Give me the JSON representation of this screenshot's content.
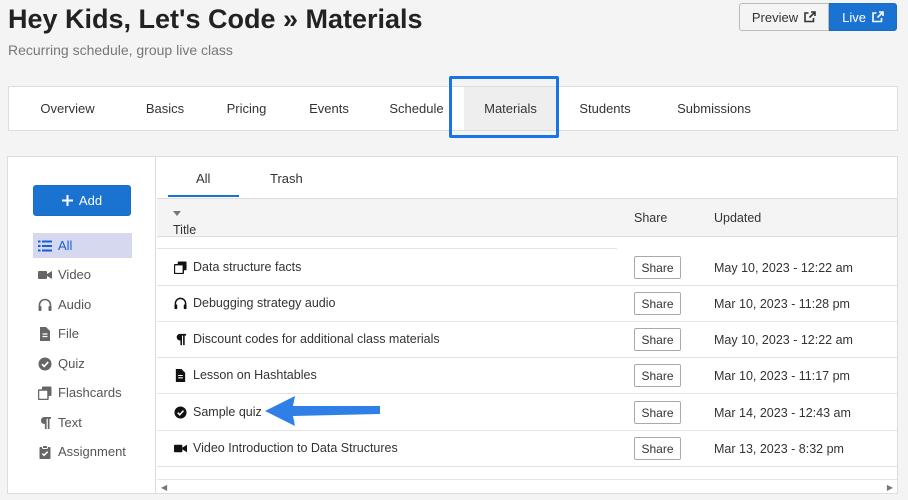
{
  "header": {
    "title": "Hey Kids, Let's Code » Materials",
    "subtitle": "Recurring schedule, group live class",
    "preview_label": "Preview",
    "live_label": "Live"
  },
  "tabs": [
    {
      "label": "Overview"
    },
    {
      "label": "Basics"
    },
    {
      "label": "Pricing"
    },
    {
      "label": "Events"
    },
    {
      "label": "Schedule"
    },
    {
      "label": "Materials",
      "active": true
    },
    {
      "label": "Students"
    },
    {
      "label": "Submissions"
    }
  ],
  "sidebar": {
    "add_label": "Add",
    "items": [
      {
        "label": "All",
        "icon": "list-icon",
        "active": true
      },
      {
        "label": "Video",
        "icon": "video-icon"
      },
      {
        "label": "Audio",
        "icon": "headphones-icon"
      },
      {
        "label": "File",
        "icon": "file-icon"
      },
      {
        "label": "Quiz",
        "icon": "check-circle-icon"
      },
      {
        "label": "Flashcards",
        "icon": "flashcards-icon"
      },
      {
        "label": "Text",
        "icon": "paragraph-icon"
      },
      {
        "label": "Assignment",
        "icon": "clipboard-icon"
      }
    ]
  },
  "subtabs": {
    "all": "All",
    "trash": "Trash"
  },
  "table": {
    "columns": {
      "title": "Title",
      "share": "Share",
      "updated": "Updated"
    },
    "share_label": "Share",
    "rows": [
      {
        "title": "Data structure facts",
        "icon": "flashcards-icon",
        "updated": "May 10, 2023 - 12:22 am"
      },
      {
        "title": "Debugging strategy audio",
        "icon": "headphones-icon",
        "updated": "Mar 10, 2023 - 11:28 pm"
      },
      {
        "title": "Discount codes for additional class materials",
        "icon": "paragraph-icon",
        "updated": "May 10, 2023 - 12:22 am"
      },
      {
        "title": "Lesson on Hashtables",
        "icon": "file-icon",
        "updated": "Mar 10, 2023 - 11:17 pm"
      },
      {
        "title": "Sample quiz",
        "icon": "check-circle-icon",
        "updated": "Mar 14, 2023 - 12:43 am"
      },
      {
        "title": "Video Introduction to Data Structures",
        "icon": "video-icon",
        "updated": "Mar 13, 2023 - 8:32 pm"
      }
    ]
  },
  "colors": {
    "accent": "#1a73d1",
    "highlight": "#1a73e8"
  }
}
